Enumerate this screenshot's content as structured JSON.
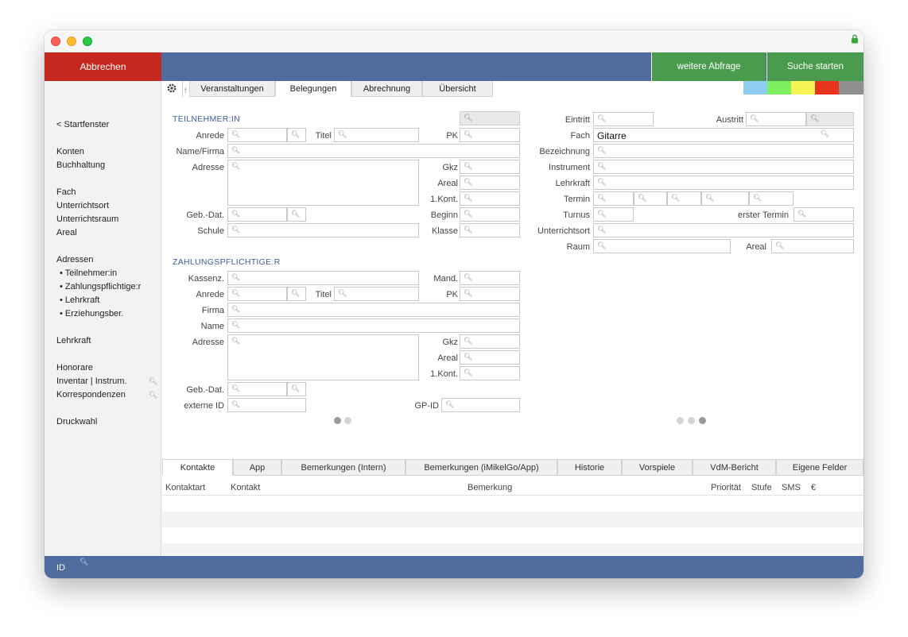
{
  "toolbar": {
    "cancel_label": "Abbrechen",
    "more_label": "weitere Abfrage",
    "search_label": "Suche starten"
  },
  "sidebar": {
    "back": "< Startfenster",
    "konten": "Konten",
    "buchhaltung": "Buchhaltung",
    "fach": "Fach",
    "unterrichtsort": "Unterrichtsort",
    "unterrichtsraum": "Unterrichtsraum",
    "areal": "Areal",
    "adressen": "Adressen",
    "adr_teilnehmer": "• Teilnehmer:in",
    "adr_zahlung": "• Zahlungspflichtige:r",
    "adr_lehrkraft": "• Lehrkraft",
    "adr_erziehung": "• Erziehungsber.",
    "lehrkraft": "Lehrkraft",
    "honorare": "Honorare",
    "inventar": "Inventar | Instrum.",
    "korrespondenzen": "Korrespondenzen",
    "druckwahl": "Druckwahl"
  },
  "tabs": {
    "f": "f",
    "veranstaltungen": "Veranstaltungen",
    "belegungen": "Belegungen",
    "abrechnung": "Abrechnung",
    "uebersicht": "Übersicht"
  },
  "swatches": {
    "blue": "#8fcdf2",
    "green": "#7ef060",
    "yellow": "#f6f454",
    "red": "#e9341f",
    "gray": "#8f8f8f"
  },
  "teilnehmer": {
    "title": "TEILNEHMER:IN",
    "anrede": "Anrede",
    "titel": "Titel",
    "pk": "PK",
    "name_firma": "Name/Firma",
    "adresse": "Adresse",
    "gkz": "Gkz",
    "areal": "Areal",
    "kont": "1.Kont.",
    "geb_dat": "Geb.-Dat.",
    "beginn": "Beginn",
    "schule": "Schule",
    "klasse": "Klasse"
  },
  "zahlung": {
    "title": "ZAHLUNGSPFLICHTIGE:R",
    "kassenz": "Kassenz.",
    "mand": "Mand.",
    "anrede": "Anrede",
    "titel": "Titel",
    "pk": "PK",
    "firma": "Firma",
    "name": "Name",
    "adresse": "Adresse",
    "gkz": "Gkz",
    "areal": "Areal",
    "kont": "1.Kont.",
    "geb_dat": "Geb.-Dat.",
    "externe_id": "externe ID",
    "gp_id": "GP-ID"
  },
  "rechts": {
    "eintritt": "Eintritt",
    "austritt": "Austritt",
    "fach": "Fach",
    "fach_value": "Gitarre",
    "bezeichnung": "Bezeichnung",
    "instrument": "Instrument",
    "lehrkraft": "Lehrkraft",
    "termin": "Termin",
    "turnus": "Turnus",
    "erster_termin": "erster Termin",
    "unterrichtsort": "Unterrichtsort",
    "raum": "Raum",
    "areal": "Areal"
  },
  "bottom_tabs": {
    "kontakte": "Kontakte",
    "app": "App",
    "bem_intern": "Bemerkungen (Intern)",
    "bem_app": "Bemerkungen (iMikelGo/App)",
    "historie": "Historie",
    "vorspiele": "Vorspiele",
    "vdm": "VdM-Bericht",
    "eigene": "Eigene Felder"
  },
  "columns": {
    "kontaktart": "Kontaktart",
    "kontakt": "Kontakt",
    "bemerkung": "Bemerkung",
    "prioritaet": "Priorität",
    "stufe": "Stufe",
    "sms": "SMS",
    "euro": "€"
  },
  "status": {
    "id": "ID"
  },
  "icons": {
    "search": "search-icon",
    "settings": "gear-icon",
    "lock": "lock-icon"
  }
}
